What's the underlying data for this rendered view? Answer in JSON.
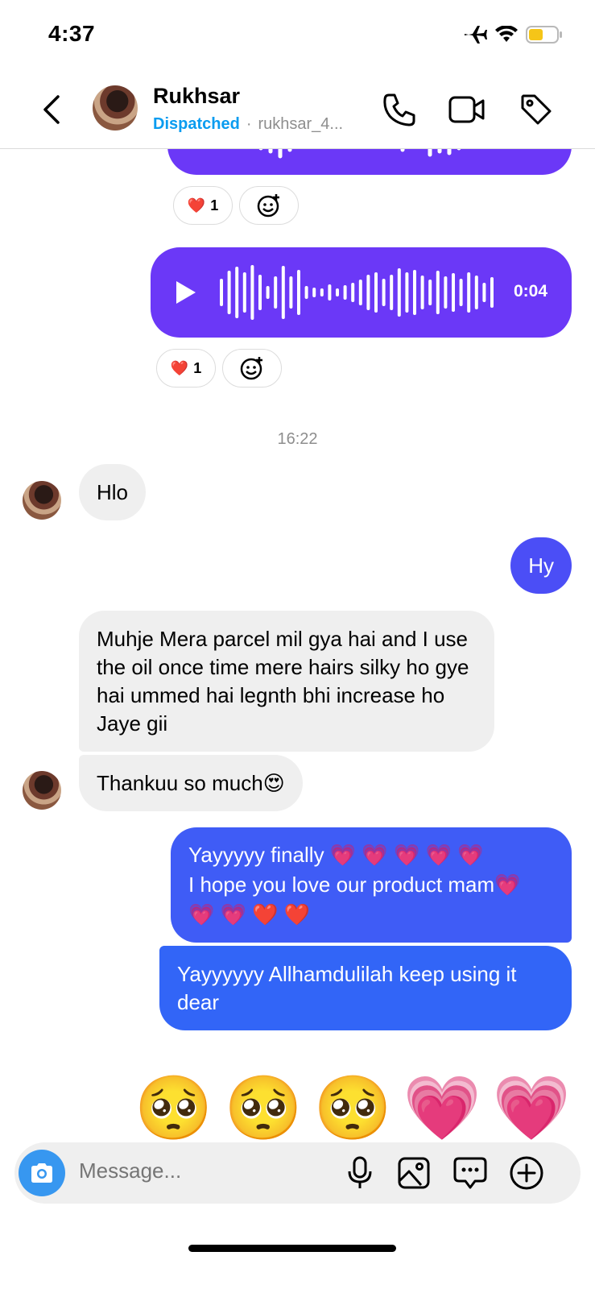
{
  "status_bar": {
    "time": "4:37",
    "icons": [
      "airplane-icon",
      "wifi-icon",
      "battery-icon"
    ],
    "battery_color": "#f5c518"
  },
  "header": {
    "back_icon": "chevron-left-icon",
    "name": "Rukhsar",
    "status": "Dispatched",
    "separator": "·",
    "username": "rukhsar_4...",
    "status_color": "#0a9cf0",
    "actions": [
      "phone-icon",
      "video-icon",
      "tag-icon"
    ]
  },
  "messages": {
    "voice_top": {
      "reaction_emoji": "❤️",
      "reaction_count": "1"
    },
    "voice_main": {
      "play_icon": "play-icon",
      "duration": "0:04",
      "reaction_emoji": "❤️",
      "reaction_count": "1"
    },
    "timestamp": "16:22",
    "in_1": "Hlo",
    "out_1": "Hy",
    "in_2": "Muhje Mera parcel mil gya hai and I use the oil once time mere hairs silky ho gye hai ummed hai legnth bhi increase ho Jaye gii",
    "in_3": "Thankuu so much😍",
    "out_2_line1": "Yayyyyy finally 💗 💗 💗 💗 💗",
    "out_2_line2": "I hope you love our product mam💗",
    "out_2_line3": "💗 💗 ❤️ ❤️",
    "out_3": "Yayyyyyy Allhamdulilah keep using it dear",
    "big_emojis": [
      "🥺",
      "🥺",
      "🥺",
      "💗",
      "💗"
    ]
  },
  "composer": {
    "placeholder": "Message...",
    "camera_icon": "camera-icon",
    "actions": [
      "microphone-icon",
      "gallery-icon",
      "sticker-icon",
      "plus-icon"
    ]
  },
  "colors": {
    "voice_bubble": "#6b38f7",
    "outgoing_bubble": "#3e5bf6",
    "incoming_bubble": "#efefef",
    "camera_button": "#3797f0"
  }
}
